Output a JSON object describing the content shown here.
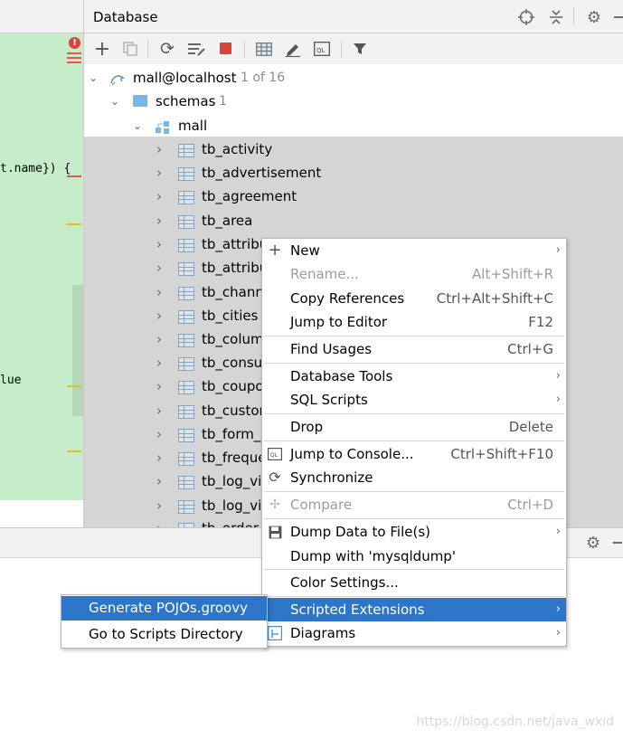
{
  "editor": {
    "code_line_1": "t.name}) {",
    "code_line_2": "lue"
  },
  "database_panel": {
    "title": "Database",
    "header_icons": [
      "crosshair-icon",
      "collapse-icon",
      "gear-icon",
      "minimize-icon"
    ],
    "toolbar_icons": [
      "add-icon",
      "duplicate-icon",
      "refresh-icon",
      "schema-sync-icon",
      "stop-icon",
      "table-view-icon",
      "edit-icon",
      "sql-console-icon",
      "filter-icon"
    ],
    "tree": {
      "connection": {
        "label": "mall@localhost",
        "count": "1 of 16"
      },
      "schemas": {
        "label": "schemas",
        "count": "1"
      },
      "schema": {
        "label": "mall"
      },
      "tables": [
        "tb_activity",
        "tb_advertisement",
        "tb_agreement",
        "tb_area",
        "tb_attribu",
        "tb_attribu",
        "tb_chann",
        "tb_cities",
        "tb_colum",
        "tb_consu",
        "tb_coupo",
        "tb_custor",
        "tb_form_",
        "tb_freque",
        "tb_log_vi",
        "tb_log_vi",
        "tb_order"
      ]
    }
  },
  "context_menu": {
    "items": [
      {
        "label": "New",
        "shortcut": "",
        "submenu": true,
        "icon": "plus-icon"
      },
      {
        "label": "Rename...",
        "shortcut": "Alt+Shift+R",
        "disabled": true
      },
      {
        "label": "Copy References",
        "shortcut": "Ctrl+Alt+Shift+C"
      },
      {
        "label": "Jump to Editor",
        "shortcut": "F12"
      },
      {
        "label": "Find Usages",
        "shortcut": "Ctrl+G"
      },
      {
        "label": "Database Tools",
        "submenu": true
      },
      {
        "label": "SQL Scripts",
        "submenu": true
      },
      {
        "label": "Drop",
        "shortcut": "Delete"
      },
      {
        "label": "Jump to Console...",
        "shortcut": "Ctrl+Shift+F10",
        "icon": "console-icon"
      },
      {
        "label": "Synchronize",
        "icon": "sync-icon"
      },
      {
        "label": "Compare",
        "shortcut": "Ctrl+D",
        "disabled": true,
        "icon": "compare-icon"
      },
      {
        "label": "Dump Data to File(s)",
        "submenu": true,
        "icon": "save-icon"
      },
      {
        "label": "Dump with 'mysqldump'"
      },
      {
        "label": "Color Settings..."
      },
      {
        "label": "Scripted Extensions",
        "submenu": true,
        "selected": true
      },
      {
        "label": "Diagrams",
        "submenu": true,
        "icon": "diagram-icon"
      }
    ]
  },
  "submenu": {
    "items": [
      {
        "label": "Generate POJOs.groovy",
        "selected": true
      },
      {
        "label": "Go to Scripts Directory"
      }
    ]
  },
  "watermark": "https://blog.csdn.net/java_wxid",
  "colors": {
    "editor_bg": "#c7ecca",
    "tree_selection_bg": "#d5d5d5",
    "menu_selected_bg": "#2d75c8"
  }
}
